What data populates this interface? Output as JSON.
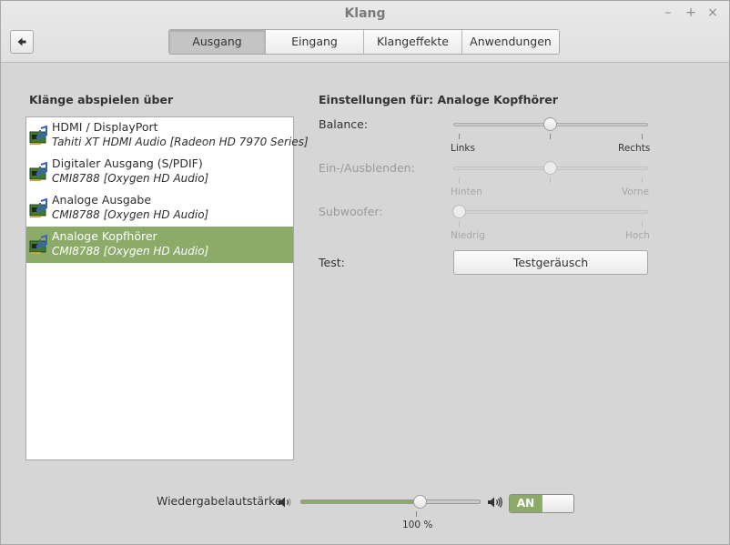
{
  "window": {
    "title": "Klang",
    "controls": [
      "–",
      "+",
      "×"
    ]
  },
  "tabs": [
    {
      "label": "Ausgang",
      "active": true
    },
    {
      "label": "Eingang",
      "active": false
    },
    {
      "label": "Klangeffekte",
      "active": false
    },
    {
      "label": "Anwendungen",
      "active": false
    }
  ],
  "output": {
    "list_title": "Klänge abspielen über",
    "devices": [
      {
        "name": "HDMI / DisplayPort",
        "description": "Tahiti XT HDMI Audio [Radeon HD 7970 Series]",
        "selected": false
      },
      {
        "name": "Digitaler Ausgang (S/PDIF)",
        "description": "CMI8788 [Oxygen HD Audio]",
        "selected": false
      },
      {
        "name": "Analoge Ausgabe",
        "description": "CMI8788 [Oxygen HD Audio]",
        "selected": false
      },
      {
        "name": "Analoge Kopfhörer",
        "description": "CMI8788 [Oxygen HD Audio]",
        "selected": true
      }
    ]
  },
  "settings": {
    "title": "Einstellungen für: Analoge Kopfhörer",
    "balance": {
      "label": "Balance:",
      "left": "Links",
      "right": "Rechts",
      "value": 0.5
    },
    "fade": {
      "label": "Ein-/Ausblenden:",
      "left": "Hinten",
      "right": "Vorne",
      "value": 0.5
    },
    "subwoofer": {
      "label": "Subwoofer:",
      "left": "Niedrig",
      "right": "Hoch",
      "value": 0.0
    },
    "test": {
      "label": "Test:",
      "button": "Testgeräusch"
    }
  },
  "volume": {
    "label": "Wiedergabelautstärke:",
    "value_text": "100 %",
    "value": 100,
    "max": 150,
    "toggle": "AN"
  },
  "colors": {
    "accent": "#8cab69"
  }
}
